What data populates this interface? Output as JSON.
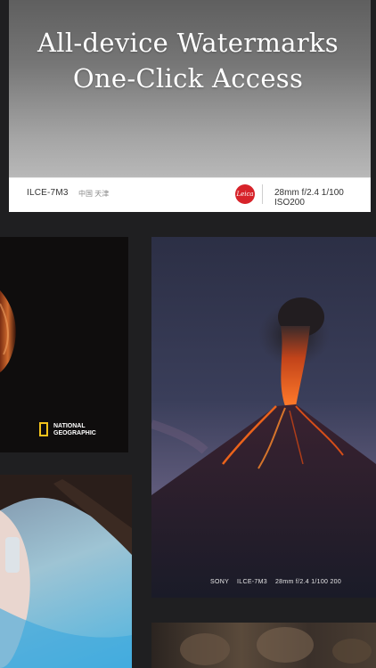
{
  "headline": {
    "line1": "All-device Watermarks",
    "line2": "One-Click Access"
  },
  "top_watermark": {
    "camera_model": "ILCE-7M3",
    "location": "中国 天津",
    "brand_logo": "Leica",
    "params": "28mm f/2.4 1/100 ISO200"
  },
  "national_geographic": {
    "line1": "NATIONAL",
    "line2": "GEOGRAPHIC"
  },
  "volcano_watermark": {
    "brand": "SONY",
    "model": "ILCE-7M3",
    "params": "28mm f/2.4 1/100 200"
  },
  "colors": {
    "background": "#1f1f21",
    "leica_red": "#d7232a",
    "ng_yellow": "#f2c21b"
  }
}
